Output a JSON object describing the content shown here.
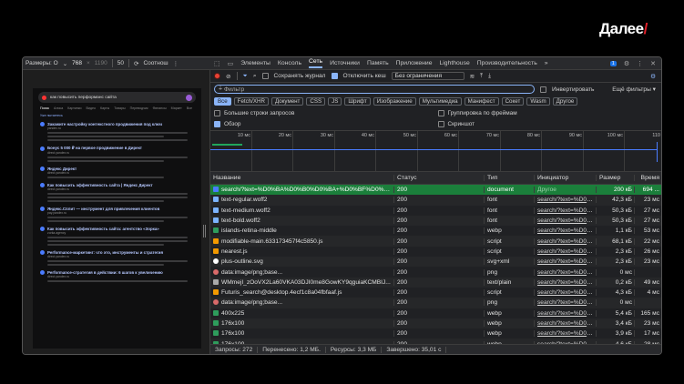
{
  "brand": {
    "logo_text": "Далее",
    "slash": "/",
    "accent": "#e0202a"
  },
  "devbar": {
    "label": "Размеры: О",
    "width": "768",
    "x": "×",
    "height": "1190",
    "zoom": "50",
    "mode": "Соотнош"
  },
  "preview": {
    "query": "как повысить перформанс сайта",
    "tabs": [
      "Поиск",
      "Алиса",
      "Картинки",
      "Видео",
      "Карты",
      "Товары",
      "Переводчик",
      "Финансы",
      "Маркет",
      "Все"
    ],
    "suggest": "Уже пытаетесь",
    "results": [
      {
        "title": "Закажите настройку контекстного продвижения под ключ",
        "url": "yandex.ru"
      },
      {
        "title": "Бонус 5 000 ₽ на первое продвижение в Директ",
        "url": "direct.yandex.ru"
      },
      {
        "title": "Яндекс Директ",
        "url": "direct.yandex.ru"
      },
      {
        "title": "Как повысить эффективность сайта | Яндекс Директ",
        "url": "direct.yandex.ru"
      },
      {
        "title": "Яндекс.Сплит — инструмент для привлечения клиентов",
        "url": "pay.yandex.ru"
      },
      {
        "title": "Как повысить эффективность сайта: агентство «Зорка»",
        "url": "zorka.agency"
      },
      {
        "title": "Performance-маркетинг: что это, инструменты и стратегия",
        "url": "direct.yandex.ru"
      },
      {
        "title": "Performance-стратегия в действии: 6 шагов к увеличению",
        "url": "direct.yandex.ru"
      }
    ]
  },
  "devtools": {
    "tabs": [
      "Элементы",
      "Консоль",
      "Сеть",
      "Источники",
      "Память",
      "Приложение",
      "Lighthouse",
      "Производительность"
    ],
    "active_tab": "Сеть",
    "more": "»",
    "issues_count": "1",
    "toolbar": {
      "preserve_log": "Сохранять журнал",
      "disable_cache": "Отключить кеш",
      "throttle": "Без ограничения"
    },
    "filter": {
      "placeholder": "Фильтр",
      "invert": "Инвертировать",
      "more_filters": "Ещё фильтры"
    },
    "types": [
      "Все",
      "Fetch/XHR",
      "Документ",
      "CSS",
      "JS",
      "Шрифт",
      "Изображение",
      "Мультимедиа",
      "Манифест",
      "Сокет",
      "Wasm",
      "Другое"
    ],
    "active_type": "Все",
    "options": {
      "big_rows": "Большие строки запросов",
      "group_by_frame": "Группировка по фреймам",
      "overview": "Обзор",
      "screenshot": "Скриншот"
    },
    "timeline_ticks": [
      "10 мс",
      "20 мс",
      "30 мс",
      "40 мс",
      "50 мс",
      "60 мс",
      "70 мс",
      "80 мс",
      "90 мс",
      "100 мс",
      "110"
    ],
    "columns": {
      "name": "Название",
      "status": "Статус",
      "type": "Тип",
      "initiator": "Инициатор",
      "size": "Размер",
      "time": "Время"
    },
    "rows": [
      {
        "icon": "doc",
        "name": "search/?text=%D0%BA%D0%B0%D0%BA+%D0%BF%D0%BE%D0...",
        "status": "200",
        "type": "document",
        "initiator": "Другое",
        "size": "200 кБ",
        "time": "694 ..."
      },
      {
        "icon": "font",
        "name": "text-regular.woff2",
        "status": "200",
        "type": "font",
        "initiator": "search/?text=%D0%B",
        "size": "42,3 кБ",
        "time": "23 мс"
      },
      {
        "icon": "font",
        "name": "text-medium.woff2",
        "status": "200",
        "type": "font",
        "initiator": "search/?text=%D0%B",
        "size": "50,3 кБ",
        "time": "27 мс"
      },
      {
        "icon": "font",
        "name": "text-bold.woff2",
        "status": "200",
        "type": "font",
        "initiator": "search/?text=%D0%B",
        "size": "50,3 кБ",
        "time": "27 мс"
      },
      {
        "icon": "img",
        "name": "islands-retina-middle",
        "status": "200",
        "type": "webp",
        "initiator": "search/?text=%D0%B",
        "size": "1,1 кБ",
        "time": "53 мс"
      },
      {
        "icon": "script",
        "name": "modifiable-main.633173457f4c5850.js",
        "status": "200",
        "type": "script",
        "initiator": "search/?text=%D0%B",
        "size": "68,1 кБ",
        "time": "22 мс"
      },
      {
        "icon": "script",
        "name": "nearest.js",
        "status": "200",
        "type": "script",
        "initiator": "search/?text=%D0%B",
        "size": "2,3 кБ",
        "time": "26 мс"
      },
      {
        "icon": "svg",
        "name": "plus-outline.svg",
        "status": "200",
        "type": "svg+xml",
        "initiator": "search/?text=%D0%B",
        "size": "2,3 кБ",
        "time": "23 мс"
      },
      {
        "icon": "data",
        "name": "data:image/png;base...",
        "status": "200",
        "type": "png",
        "initiator": "search/?text=%D0%B (кэш памя...",
        "size": "0 мс",
        "time": ""
      },
      {
        "icon": "text",
        "name": "WMmejI_zOoVX2La60VKA03DJI0me8GowKY9qguiaKCMBIJ...",
        "status": "200",
        "type": "text/plain",
        "initiator": "search/?text=%D0%B",
        "size": "0,2 кБ",
        "time": "49 мс"
      },
      {
        "icon": "script",
        "name": "Futuris_search@desktop.4ecf1c8a04fbfaaf.js",
        "status": "200",
        "type": "script",
        "initiator": "search/?text=%D0%B",
        "size": "4,3 кБ",
        "time": "4 мс"
      },
      {
        "icon": "data",
        "name": "data:image/png;base...",
        "status": "200",
        "type": "png",
        "initiator": "search/?text=%D0%B (кэш памя...",
        "size": "0 мс",
        "time": ""
      },
      {
        "icon": "img",
        "name": "400x225",
        "status": "200",
        "type": "webp",
        "initiator": "search/?text=%D0%B",
        "size": "5,4 кБ",
        "time": "165 мс"
      },
      {
        "icon": "img",
        "name": "176x100",
        "status": "200",
        "type": "webp",
        "initiator": "search/?text=%D0%B",
        "size": "3,4 кБ",
        "time": "23 мс"
      },
      {
        "icon": "img",
        "name": "176x100",
        "status": "200",
        "type": "webp",
        "initiator": "search/?text=%D0%B",
        "size": "3,9 кБ",
        "time": "17 мс"
      },
      {
        "icon": "img",
        "name": "176x100",
        "status": "200",
        "type": "webp",
        "initiator": "search/?text=%D0%B",
        "size": "4,6 кБ",
        "time": "28 мс"
      }
    ],
    "status_bar": {
      "requests": "Запросы: 272",
      "transferred": "Перенесено: 1,2 МБ.",
      "resources": "Ресурсы: 3,3 МБ",
      "finished": "Завершено: 35,01 с"
    }
  }
}
